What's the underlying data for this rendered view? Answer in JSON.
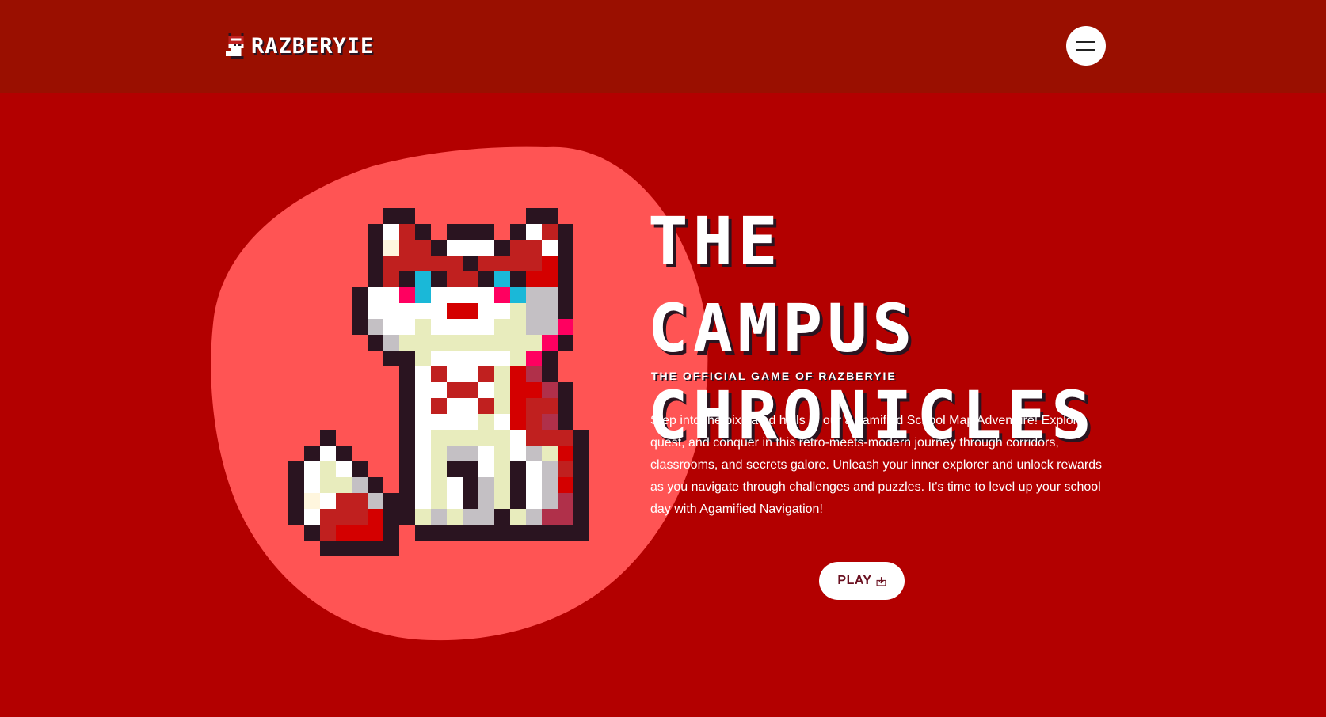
{
  "header": {
    "brand": "RAZBERYIE",
    "logo_icon": "fox-logo-icon",
    "menu_icon": "hamburger-menu-icon"
  },
  "hero": {
    "title": "THE CAMPUS CHRONICLES",
    "subtitle": "THE OFFICIAL GAME OF RAZBERYIE",
    "description": "Step into the pixelated halls of our a gamified School Map Adventure! Explore, quest, and conquer in this retro-meets-modern journey through corridors, classrooms, and secrets galore. Unleash your inner explorer and unlock rewards as you navigate through challenges and puzzles. It's time to level up your school day with Agamified Navigation!",
    "play_label": "PLAY",
    "play_icon": "download-icon",
    "mascot": "pixel-fox-mascot"
  },
  "colors": {
    "header_bg": "#9a0f00",
    "page_bg": "#b30000",
    "blob": "#ff5454",
    "text": "#ffffff",
    "accent_dark": "#2a1420"
  }
}
